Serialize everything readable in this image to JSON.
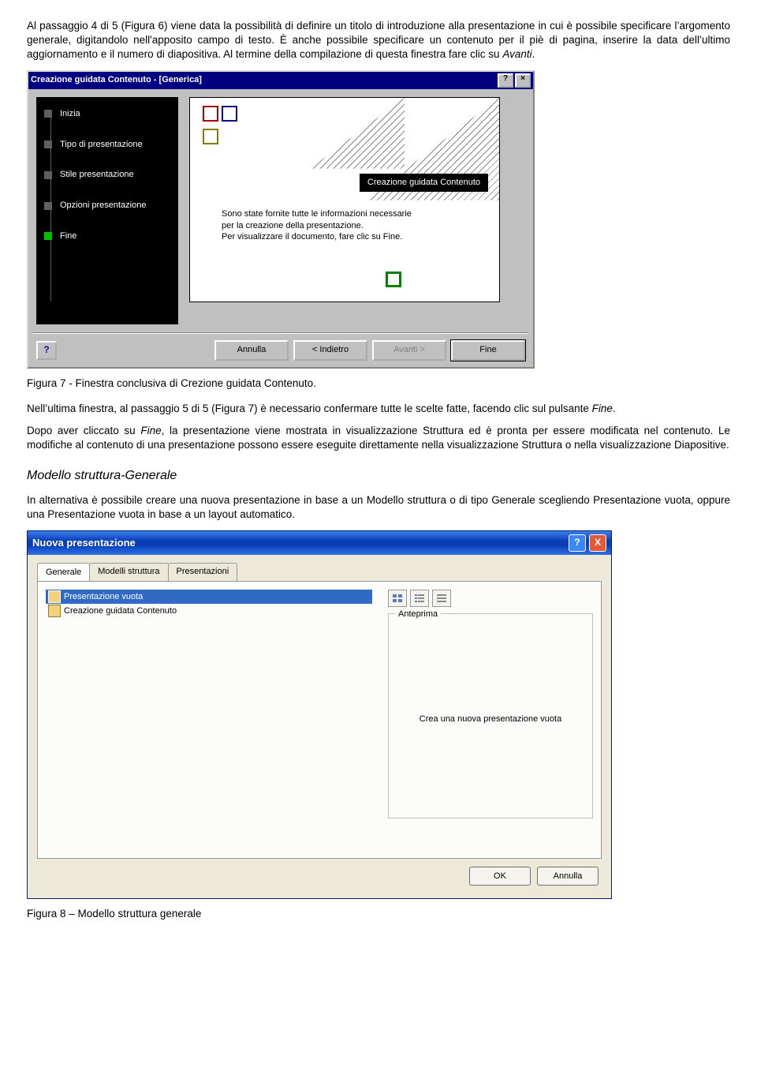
{
  "para1": "Al passaggio 4 di 5 (Figura 6) viene data la possibilità di definire un titolo di introduzione alla presentazione in cui è possibile specificare l’argomento generale, digitandolo nell'apposito campo di testo. È anche possibile specificare un contenuto per il piè di pagina, inserire la data dell’ultimo aggiornamento e il numero di diapositiva. Al termine della compilazione di questa finestra fare clic su ",
  "para1_em": "Avanti",
  "fig7": {
    "title": "Creazione guidata Contenuto - [Generica]",
    "steps": [
      "Inizia",
      "Tipo di presentazione",
      "Stile presentazione",
      "Opzioni presentazione",
      "Fine"
    ],
    "banner": "Creazione guidata Contenuto",
    "msg1": "Sono state fornite tutte le informazioni necessarie per la creazione della presentazione.",
    "msg2": "Per visualizzare il documento, fare clic su Fine.",
    "help": "?",
    "btn_cancel": "Annulla",
    "btn_back": "< Indietro",
    "btn_next": "Avanti >",
    "btn_finish": "Fine",
    "close_q": "?",
    "close_x": "×"
  },
  "caption7": "Figura 7 - Finestra conclusiva di Crezione guidata Contenuto.",
  "para2a": "Nell’ultima finestra, al passaggio 5 di 5 (Figura 7) è necessario confermare tutte le scelte fatte, facendo clic sul pulsante ",
  "para2a_em": "Fine",
  "para2b1": "Dopo aver cliccato su ",
  "para2b_em": "Fine",
  "para2b2": ", la presentazione viene mostrata in visualizzazione Struttura ed è pronta per essere modificata nel contenuto. Le modifiche al contenuto di una presentazione possono essere eseguite direttamente nella visualizzazione Struttura o nella visualizzazione Diapositive.",
  "subheading": "Modello struttura-Generale",
  "para3": "In alternativa è possibile creare una nuova presentazione in base a un Modello struttura o di tipo Generale scegliendo Presentazione vuota, oppure una Presentazione vuota in base a un layout automatico.",
  "fig8": {
    "title": "Nuova presentazione",
    "tabs": [
      "Generale",
      "Modelli struttura",
      "Presentazioni"
    ],
    "item_sel": "Presentazione vuota",
    "item_other": "Creazione guidata Contenuto",
    "group_label": "Anteprima",
    "group_text": "Crea una nuova presentazione vuota",
    "btn_ok": "OK",
    "btn_cancel": "Annulla",
    "help": "?",
    "close": "X"
  },
  "caption8": "Figura 8 – Modello struttura generale"
}
